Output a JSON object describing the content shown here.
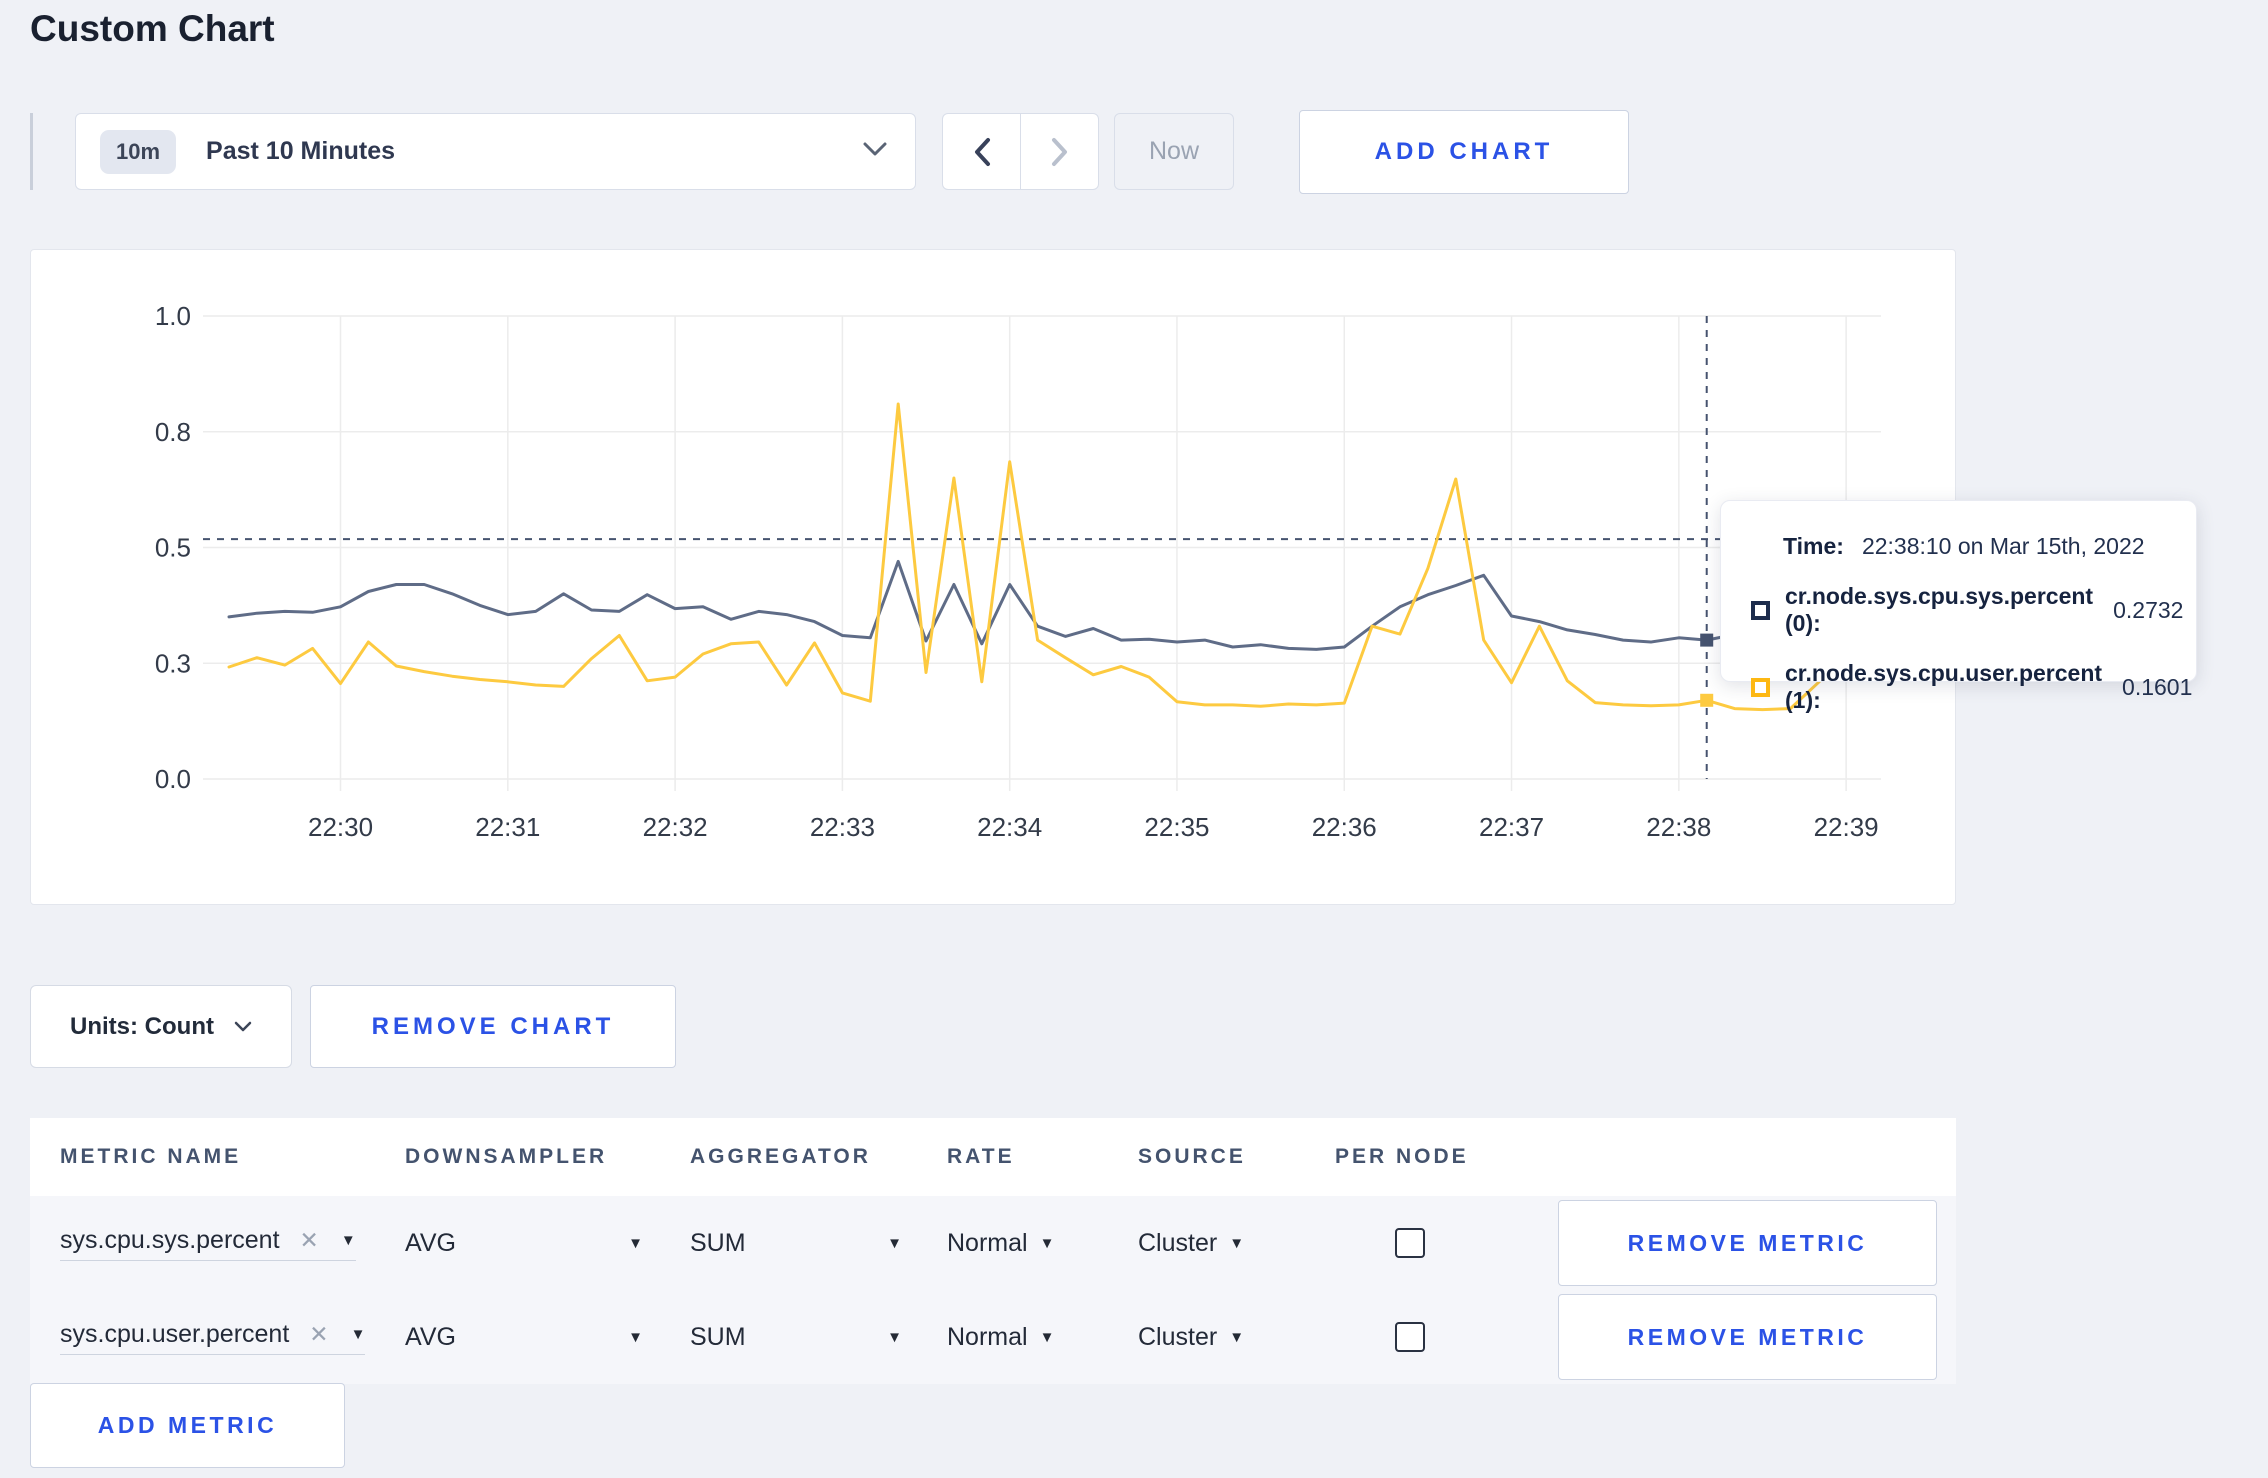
{
  "page": {
    "title": "Custom Chart"
  },
  "toolbar": {
    "time_badge": "10m",
    "time_label": "Past 10 Minutes",
    "now_label": "Now",
    "add_chart_label": "ADD CHART"
  },
  "chart_data": {
    "type": "line",
    "title": "",
    "xlabel": "",
    "ylabel": "",
    "ylim": [
      0,
      1
    ],
    "grid": true,
    "x_start": "22:29:20",
    "x_step_seconds": 10,
    "x_tick_labels": [
      "22:30",
      "22:31",
      "22:32",
      "22:33",
      "22:34",
      "22:35",
      "22:36",
      "22:37",
      "22:38",
      "22:39"
    ],
    "x_tick_indices": [
      4,
      10,
      16,
      22,
      28,
      34,
      40,
      46,
      52,
      58
    ],
    "y_tick_labels": [
      "0.0",
      "0.3",
      "0.5",
      "0.8",
      "1.0"
    ],
    "y_tick_values": [
      0,
      0.25,
      0.5,
      0.75,
      1.0
    ],
    "series": [
      {
        "name": "cr.node.sys.cpu.sys.percent (0)",
        "color": "#5f6c87",
        "values": [
          0.35,
          0.358,
          0.362,
          0.36,
          0.372,
          0.405,
          0.42,
          0.42,
          0.4,
          0.375,
          0.355,
          0.362,
          0.4,
          0.365,
          0.362,
          0.398,
          0.368,
          0.372,
          0.345,
          0.362,
          0.355,
          0.34,
          0.31,
          0.305,
          0.47,
          0.298,
          0.42,
          0.292,
          0.42,
          0.33,
          0.308,
          0.325,
          0.3,
          0.302,
          0.296,
          0.3,
          0.285,
          0.29,
          0.282,
          0.28,
          0.285,
          0.33,
          0.372,
          0.398,
          0.418,
          0.44,
          0.352,
          0.34,
          0.322,
          0.312,
          0.3,
          0.296,
          0.305,
          0.3,
          0.312,
          0.328,
          0.33,
          0.322,
          0.326,
          0.35
        ]
      },
      {
        "name": "cr.node.sys.cpu.user.percent (1)",
        "color": "#fdca40",
        "values": [
          0.242,
          0.262,
          0.246,
          0.282,
          0.206,
          0.296,
          0.244,
          0.232,
          0.222,
          0.215,
          0.21,
          0.203,
          0.2,
          0.26,
          0.31,
          0.212,
          0.22,
          0.27,
          0.292,
          0.296,
          0.203,
          0.294,
          0.186,
          0.168,
          0.81,
          0.23,
          0.65,
          0.21,
          0.685,
          0.3,
          0.262,
          0.225,
          0.243,
          0.22,
          0.167,
          0.16,
          0.16,
          0.157,
          0.162,
          0.16,
          0.164,
          0.33,
          0.313,
          0.455,
          0.648,
          0.3,
          0.208,
          0.33,
          0.212,
          0.165,
          0.16,
          0.158,
          0.16,
          0.17,
          0.152,
          0.15,
          0.152,
          0.208,
          0.272,
          0.252
        ]
      }
    ],
    "crosshair": {
      "index": 53,
      "hline_value": 0.518,
      "line_color": "#46536f"
    },
    "grid_color": "#ececec",
    "axis_text_color": "#333b49",
    "legend_position": "tooltip"
  },
  "tooltip": {
    "time_label": "Time:",
    "time_value": "22:38:10 on Mar 15th, 2022",
    "series": [
      {
        "label": "cr.node.sys.cpu.sys.percent (0):",
        "value": "0.2732",
        "color": "#1d2c4c"
      },
      {
        "label": "cr.node.sys.cpu.user.percent (1):",
        "value": "0.1601",
        "color": "#fdb813"
      }
    ]
  },
  "chart_controls": {
    "units_label": "Units: Count",
    "remove_chart_label": "REMOVE CHART"
  },
  "metrics_table": {
    "headers": [
      "METRIC NAME",
      "DOWNSAMPLER",
      "AGGREGATOR",
      "RATE",
      "SOURCE",
      "PER NODE"
    ],
    "clear_glyph": "✕",
    "rows": [
      {
        "metric": "sys.cpu.sys.percent",
        "downsampler": "AVG",
        "aggregator": "SUM",
        "rate": "Normal",
        "source": "Cluster",
        "per_node_checked": false,
        "remove_label": "REMOVE METRIC"
      },
      {
        "metric": "sys.cpu.user.percent",
        "downsampler": "AVG",
        "aggregator": "SUM",
        "rate": "Normal",
        "source": "Cluster",
        "per_node_checked": false,
        "remove_label": "REMOVE METRIC"
      }
    ],
    "add_metric_label": "ADD METRIC"
  },
  "colors": {
    "accent_blue": "#2b52e6",
    "page_background": "#eff1f6",
    "row_background": "#f5f6fa"
  }
}
